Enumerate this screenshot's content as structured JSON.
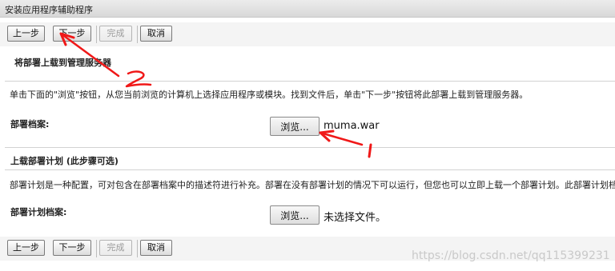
{
  "window": {
    "title": "安装应用程序辅助程序"
  },
  "toolbar_top": {
    "prev": "上一步",
    "next": "下一步",
    "finish": "完成",
    "cancel": "取消"
  },
  "toolbar_bottom": {
    "prev": "上一步",
    "next": "下一步",
    "finish": "完成",
    "cancel": "取消"
  },
  "section1": {
    "title": "将部署上载到管理服务器",
    "description": "单击下面的\"浏览\"按钮，从您当前浏览的计算机上选择应用程序或模块。找到文件后，单击\"下一步\"按钮将此部署上载到管理服务器。",
    "archive_label": "部署档案:",
    "browse_label": "浏览...",
    "file_name": "muma.war"
  },
  "section2": {
    "title": "上载部署计划 (此步骤可选)",
    "description": "部署计划是一种配置，可对包含在部署档案中的描述符进行补充。部署在没有部署计划的情况下可以运行，但您也可以立即上载一个部署计划。此部署计划档",
    "plan_label": "部署计划档案:",
    "browse_label": "浏览...",
    "file_status": "未选择文件。"
  },
  "annotations": {
    "mark1": "1",
    "mark2": "2",
    "color": "#f01818"
  },
  "watermark": "https://blog.csdn.net/qq115399231"
}
